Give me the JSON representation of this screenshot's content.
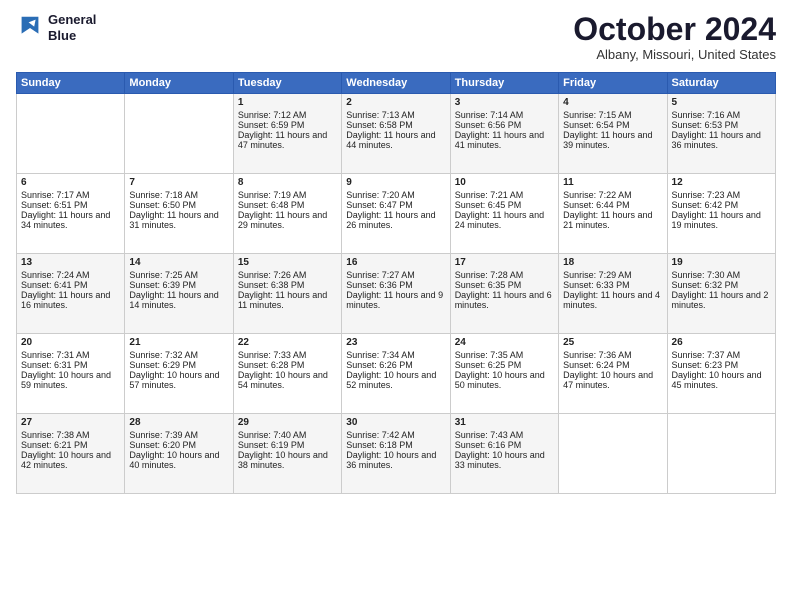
{
  "logo": {
    "line1": "General",
    "line2": "Blue"
  },
  "title": "October 2024",
  "location": "Albany, Missouri, United States",
  "days_of_week": [
    "Sunday",
    "Monday",
    "Tuesday",
    "Wednesday",
    "Thursday",
    "Friday",
    "Saturday"
  ],
  "weeks": [
    [
      {
        "day": "",
        "sunrise": "",
        "sunset": "",
        "daylight": ""
      },
      {
        "day": "",
        "sunrise": "",
        "sunset": "",
        "daylight": ""
      },
      {
        "day": "1",
        "sunrise": "Sunrise: 7:12 AM",
        "sunset": "Sunset: 6:59 PM",
        "daylight": "Daylight: 11 hours and 47 minutes."
      },
      {
        "day": "2",
        "sunrise": "Sunrise: 7:13 AM",
        "sunset": "Sunset: 6:58 PM",
        "daylight": "Daylight: 11 hours and 44 minutes."
      },
      {
        "day": "3",
        "sunrise": "Sunrise: 7:14 AM",
        "sunset": "Sunset: 6:56 PM",
        "daylight": "Daylight: 11 hours and 41 minutes."
      },
      {
        "day": "4",
        "sunrise": "Sunrise: 7:15 AM",
        "sunset": "Sunset: 6:54 PM",
        "daylight": "Daylight: 11 hours and 39 minutes."
      },
      {
        "day": "5",
        "sunrise": "Sunrise: 7:16 AM",
        "sunset": "Sunset: 6:53 PM",
        "daylight": "Daylight: 11 hours and 36 minutes."
      }
    ],
    [
      {
        "day": "6",
        "sunrise": "Sunrise: 7:17 AM",
        "sunset": "Sunset: 6:51 PM",
        "daylight": "Daylight: 11 hours and 34 minutes."
      },
      {
        "day": "7",
        "sunrise": "Sunrise: 7:18 AM",
        "sunset": "Sunset: 6:50 PM",
        "daylight": "Daylight: 11 hours and 31 minutes."
      },
      {
        "day": "8",
        "sunrise": "Sunrise: 7:19 AM",
        "sunset": "Sunset: 6:48 PM",
        "daylight": "Daylight: 11 hours and 29 minutes."
      },
      {
        "day": "9",
        "sunrise": "Sunrise: 7:20 AM",
        "sunset": "Sunset: 6:47 PM",
        "daylight": "Daylight: 11 hours and 26 minutes."
      },
      {
        "day": "10",
        "sunrise": "Sunrise: 7:21 AM",
        "sunset": "Sunset: 6:45 PM",
        "daylight": "Daylight: 11 hours and 24 minutes."
      },
      {
        "day": "11",
        "sunrise": "Sunrise: 7:22 AM",
        "sunset": "Sunset: 6:44 PM",
        "daylight": "Daylight: 11 hours and 21 minutes."
      },
      {
        "day": "12",
        "sunrise": "Sunrise: 7:23 AM",
        "sunset": "Sunset: 6:42 PM",
        "daylight": "Daylight: 11 hours and 19 minutes."
      }
    ],
    [
      {
        "day": "13",
        "sunrise": "Sunrise: 7:24 AM",
        "sunset": "Sunset: 6:41 PM",
        "daylight": "Daylight: 11 hours and 16 minutes."
      },
      {
        "day": "14",
        "sunrise": "Sunrise: 7:25 AM",
        "sunset": "Sunset: 6:39 PM",
        "daylight": "Daylight: 11 hours and 14 minutes."
      },
      {
        "day": "15",
        "sunrise": "Sunrise: 7:26 AM",
        "sunset": "Sunset: 6:38 PM",
        "daylight": "Daylight: 11 hours and 11 minutes."
      },
      {
        "day": "16",
        "sunrise": "Sunrise: 7:27 AM",
        "sunset": "Sunset: 6:36 PM",
        "daylight": "Daylight: 11 hours and 9 minutes."
      },
      {
        "day": "17",
        "sunrise": "Sunrise: 7:28 AM",
        "sunset": "Sunset: 6:35 PM",
        "daylight": "Daylight: 11 hours and 6 minutes."
      },
      {
        "day": "18",
        "sunrise": "Sunrise: 7:29 AM",
        "sunset": "Sunset: 6:33 PM",
        "daylight": "Daylight: 11 hours and 4 minutes."
      },
      {
        "day": "19",
        "sunrise": "Sunrise: 7:30 AM",
        "sunset": "Sunset: 6:32 PM",
        "daylight": "Daylight: 11 hours and 2 minutes."
      }
    ],
    [
      {
        "day": "20",
        "sunrise": "Sunrise: 7:31 AM",
        "sunset": "Sunset: 6:31 PM",
        "daylight": "Daylight: 10 hours and 59 minutes."
      },
      {
        "day": "21",
        "sunrise": "Sunrise: 7:32 AM",
        "sunset": "Sunset: 6:29 PM",
        "daylight": "Daylight: 10 hours and 57 minutes."
      },
      {
        "day": "22",
        "sunrise": "Sunrise: 7:33 AM",
        "sunset": "Sunset: 6:28 PM",
        "daylight": "Daylight: 10 hours and 54 minutes."
      },
      {
        "day": "23",
        "sunrise": "Sunrise: 7:34 AM",
        "sunset": "Sunset: 6:26 PM",
        "daylight": "Daylight: 10 hours and 52 minutes."
      },
      {
        "day": "24",
        "sunrise": "Sunrise: 7:35 AM",
        "sunset": "Sunset: 6:25 PM",
        "daylight": "Daylight: 10 hours and 50 minutes."
      },
      {
        "day": "25",
        "sunrise": "Sunrise: 7:36 AM",
        "sunset": "Sunset: 6:24 PM",
        "daylight": "Daylight: 10 hours and 47 minutes."
      },
      {
        "day": "26",
        "sunrise": "Sunrise: 7:37 AM",
        "sunset": "Sunset: 6:23 PM",
        "daylight": "Daylight: 10 hours and 45 minutes."
      }
    ],
    [
      {
        "day": "27",
        "sunrise": "Sunrise: 7:38 AM",
        "sunset": "Sunset: 6:21 PM",
        "daylight": "Daylight: 10 hours and 42 minutes."
      },
      {
        "day": "28",
        "sunrise": "Sunrise: 7:39 AM",
        "sunset": "Sunset: 6:20 PM",
        "daylight": "Daylight: 10 hours and 40 minutes."
      },
      {
        "day": "29",
        "sunrise": "Sunrise: 7:40 AM",
        "sunset": "Sunset: 6:19 PM",
        "daylight": "Daylight: 10 hours and 38 minutes."
      },
      {
        "day": "30",
        "sunrise": "Sunrise: 7:42 AM",
        "sunset": "Sunset: 6:18 PM",
        "daylight": "Daylight: 10 hours and 36 minutes."
      },
      {
        "day": "31",
        "sunrise": "Sunrise: 7:43 AM",
        "sunset": "Sunset: 6:16 PM",
        "daylight": "Daylight: 10 hours and 33 minutes."
      },
      {
        "day": "",
        "sunrise": "",
        "sunset": "",
        "daylight": ""
      },
      {
        "day": "",
        "sunrise": "",
        "sunset": "",
        "daylight": ""
      }
    ]
  ]
}
